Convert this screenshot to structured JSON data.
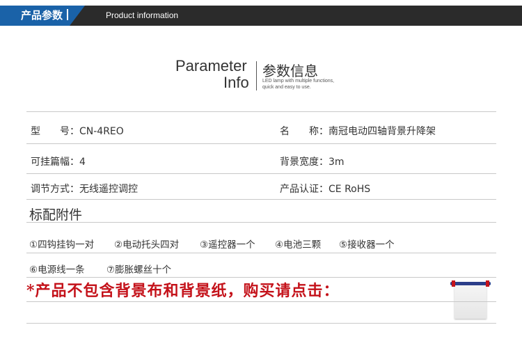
{
  "header": {
    "title_cn": "产品参数",
    "title_en": "Product information"
  },
  "heading": {
    "en_line1": "Parameter",
    "en_line2": "Info",
    "cn": "参数信息",
    "sub_line1": "LED lamp with multiple functions,",
    "sub_line2": "quick and easy to use."
  },
  "params": [
    {
      "label": "型　　号：",
      "value": "CN-4REO"
    },
    {
      "label": "名　　称：",
      "value": "南冠电动四轴背景升降架"
    },
    {
      "label": "可挂篇幅：",
      "value": "4"
    },
    {
      "label": "背景宽度：",
      "value": "3m"
    },
    {
      "label": "调节方式：",
      "value": "无线遥控调控"
    },
    {
      "label": "产品认证：",
      "value": "CE RoHS"
    }
  ],
  "accessories": {
    "title": "标配附件",
    "items": [
      "①四钩挂钩一对",
      "②电动托头四对",
      "③遥控器一个",
      "④电池三颗",
      "⑤接收器一个",
      "⑥电源线一条",
      "⑦膨胀螺丝十个"
    ]
  },
  "notice": "*产品不包含背景布和背景纸，购买请点击：",
  "colors": {
    "accent_blue": "#1a62a8",
    "bar_dark": "#2b2b2b",
    "notice_red": "#c4121a"
  }
}
